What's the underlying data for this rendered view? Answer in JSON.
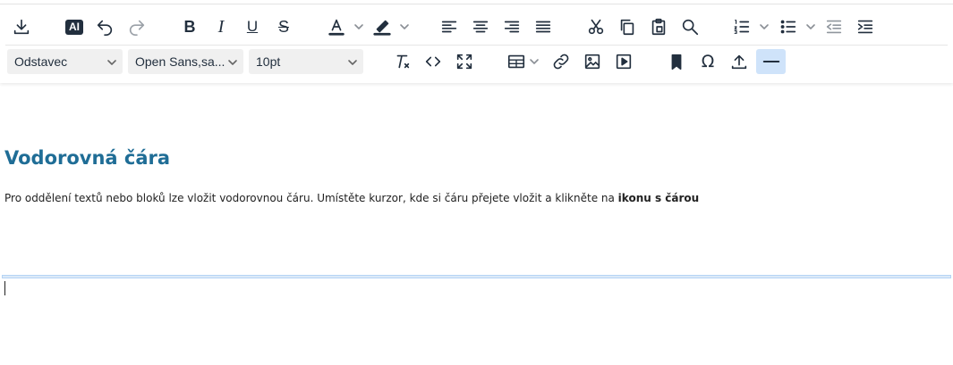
{
  "toolbar": {
    "row1": [
      {
        "name": "download-icon"
      },
      {
        "name": "ai-assistant-button",
        "label": "AI"
      },
      {
        "name": "undo-icon"
      },
      {
        "name": "redo-icon"
      },
      {
        "name": "bold-icon",
        "label": "B"
      },
      {
        "name": "italic-icon",
        "label": "I"
      },
      {
        "name": "underline-icon",
        "label": "U"
      },
      {
        "name": "strikethrough-icon",
        "label": "S"
      },
      {
        "name": "text-color-icon",
        "label": "A",
        "color": "#222f3e"
      },
      {
        "name": "highlight-color-icon",
        "color": "#222f3e"
      },
      {
        "name": "align-left-icon"
      },
      {
        "name": "align-center-icon"
      },
      {
        "name": "align-right-icon"
      },
      {
        "name": "align-justify-icon"
      },
      {
        "name": "cut-icon"
      },
      {
        "name": "copy-icon"
      },
      {
        "name": "paste-icon"
      },
      {
        "name": "search-icon"
      },
      {
        "name": "numbered-list-icon"
      },
      {
        "name": "bullet-list-icon"
      },
      {
        "name": "outdent-icon"
      },
      {
        "name": "indent-icon"
      }
    ],
    "block_format": "Odstavec",
    "font_family": "Open Sans,sa...",
    "font_size": "10pt",
    "row2": [
      {
        "name": "clear-formatting-icon"
      },
      {
        "name": "source-code-icon"
      },
      {
        "name": "fullscreen-icon"
      },
      {
        "name": "table-icon"
      },
      {
        "name": "link-icon"
      },
      {
        "name": "image-icon"
      },
      {
        "name": "media-icon"
      },
      {
        "name": "bookmark-icon"
      },
      {
        "name": "special-character-icon",
        "label": "Ω"
      },
      {
        "name": "upload-icon"
      },
      {
        "name": "horizontal-line-icon",
        "active": true
      }
    ],
    "active_color": "#cfe3fa"
  },
  "document": {
    "heading": "Vodorovná čára",
    "heading_color": "#1f6d96",
    "paragraph_text": "Pro oddělení textů nebo bloků lze vložit vodorovnou čáru. Umístěte kurzor, kde si čáru přejete vložit a klikněte na ",
    "paragraph_bold": "ikonu s čárou"
  }
}
